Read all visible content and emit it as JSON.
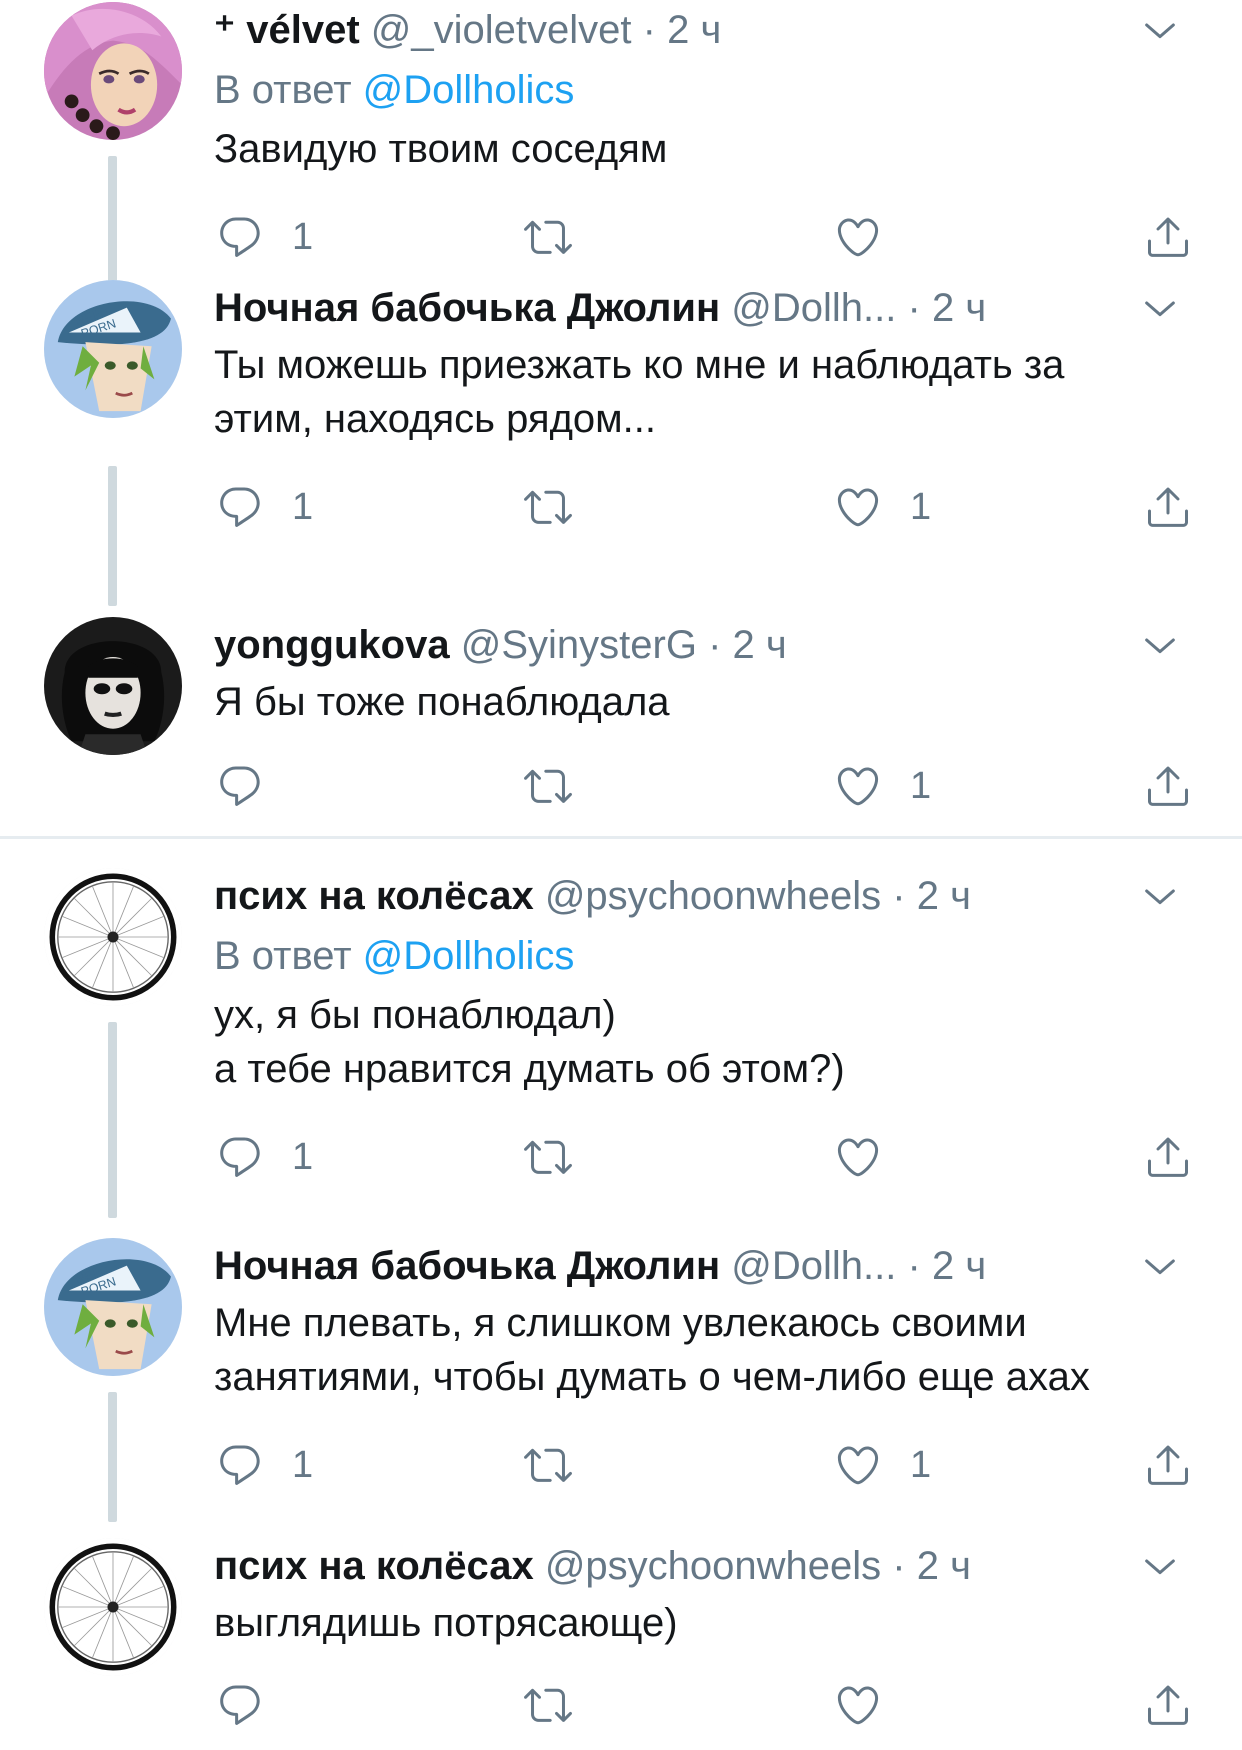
{
  "tweets": [
    {
      "name": "⁺ vélvet",
      "handle": "@_violetvelvet",
      "dot": "·",
      "time": "2 ч",
      "reply_label": "В ответ",
      "reply_to": "@Dollholics",
      "text_lines": [
        "Завидую твоим соседям"
      ],
      "reply_count": "1",
      "retweet_count": "",
      "like_count": ""
    },
    {
      "name": "Ночная бабочька Джолин",
      "handle": "@Dollh...",
      "dot": "·",
      "time": "2 ч",
      "text_lines": [
        "Ты можешь приезжать ко мне и наблюдать за",
        "этим, находясь рядом..."
      ],
      "reply_count": "1",
      "retweet_count": "",
      "like_count": "1"
    },
    {
      "name": "yonggukova",
      "handle": "@SyinysterG",
      "dot": "·",
      "time": "2 ч",
      "text_lines": [
        "Я бы тоже понаблюдала"
      ],
      "reply_count": "",
      "retweet_count": "",
      "like_count": "1"
    },
    {
      "name": "псих на колёсах",
      "handle": "@psychoonwheels",
      "dot": "·",
      "time": "2 ч",
      "reply_label": "В ответ",
      "reply_to": "@Dollholics",
      "text_lines": [
        "ух, я бы понаблюдал)",
        "а тебе нравится думать об этом?)"
      ],
      "reply_count": "1",
      "retweet_count": "",
      "like_count": ""
    },
    {
      "name": "Ночная бабочька Джолин",
      "handle": "@Dollh...",
      "dot": "·",
      "time": "2 ч",
      "text_lines": [
        "Мне плевать, я слишком увлекаюсь своими",
        "занятиями, чтобы думать о чем-либо еще ахах"
      ],
      "reply_count": "1",
      "retweet_count": "",
      "like_count": "1"
    },
    {
      "name": "псих на колёсах",
      "handle": "@psychoonwheels",
      "dot": "·",
      "time": "2 ч",
      "text_lines": [
        "выглядишь потрясающе)"
      ],
      "reply_count": "",
      "retweet_count": "",
      "like_count": ""
    }
  ],
  "icons": {
    "reply": "reply-icon",
    "retweet": "retweet-icon",
    "like": "heart-icon",
    "share": "share-icon",
    "caret": "chevron-down-icon"
  },
  "colors": {
    "link": "#1da1f2",
    "secondary_text": "#657786",
    "thread_line": "#cfd9de",
    "divider": "#e6ecf0"
  }
}
